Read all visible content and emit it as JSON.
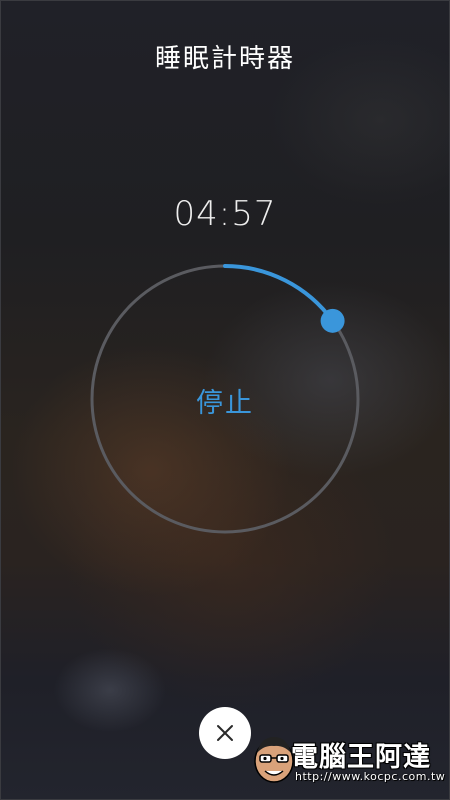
{
  "header": {
    "title": "睡眠計時器"
  },
  "timer": {
    "remaining_time": "04:57",
    "progress_fraction": 0.15
  },
  "controls": {
    "stop_label": "停止",
    "close_icon": "close-icon"
  },
  "colors": {
    "accent": "#3a96db",
    "ring_track": "#5a5b60",
    "title_text": "#ffffff"
  },
  "watermark": {
    "logo_text": "電腦王阿達",
    "url": "http://www.kocpc.com.tw"
  }
}
